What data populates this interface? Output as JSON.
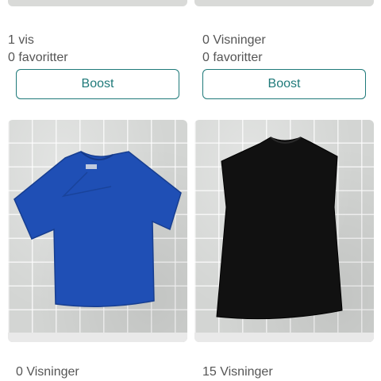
{
  "listings": [
    {
      "views": "1 vis",
      "favorites": "0 favoritter",
      "boost_label": "Boost"
    },
    {
      "views": "0 Visninger",
      "favorites": "0 favoritter",
      "boost_label": "Boost"
    },
    {
      "views": "0 Visninger",
      "colors": {
        "garment": "#1f4fb5"
      }
    },
    {
      "views": "15 Visninger",
      "colors": {
        "garment": "#111111"
      }
    }
  ],
  "colors": {
    "accent": "#1f7a7a",
    "background": "#ffffff",
    "text": "#555555"
  }
}
